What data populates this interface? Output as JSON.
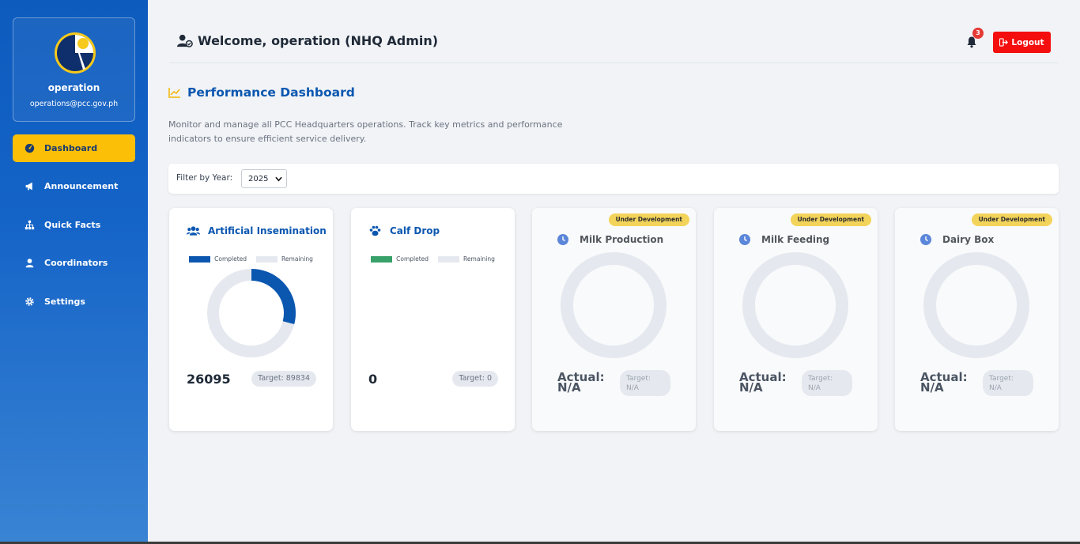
{
  "user": {
    "name": "operation",
    "email": "operations@pcc.gov.ph"
  },
  "sidebar": {
    "items": [
      {
        "label": "Dashboard",
        "icon": "gauge-icon",
        "active": true
      },
      {
        "label": "Announcement",
        "icon": "megaphone-icon"
      },
      {
        "label": "Quick Facts",
        "icon": "sitemap-icon"
      },
      {
        "label": "Coordinators",
        "icon": "user-icon"
      },
      {
        "label": "Settings",
        "icon": "gear-icon"
      }
    ]
  },
  "header": {
    "welcome": "Welcome, operation (NHQ Admin)",
    "notification_count": "3",
    "logout_label": "Logout"
  },
  "page": {
    "title": "Performance Dashboard",
    "description": "Monitor and manage all PCC Headquarters operations. Track key metrics and performance indicators to ensure efficient service delivery."
  },
  "filter": {
    "label": "Filter by Year:",
    "year": "2025"
  },
  "legend": {
    "completed": "Completed",
    "remaining": "Remaining"
  },
  "cards": [
    {
      "title": "Artificial Insemination",
      "actual": "26095",
      "target": "Target: 89834",
      "completed_fraction": 0.29,
      "color": "#0b57b0"
    },
    {
      "title": "Calf Drop",
      "actual": "0",
      "target": "Target: 0",
      "completed_fraction": 0,
      "color": "#38a169"
    }
  ],
  "dev_cards": [
    {
      "badge": "Under Development",
      "title": "Milk Production",
      "actual": "Actual: N/A",
      "target": "Target: N/A"
    },
    {
      "badge": "Under Development",
      "title": "Milk Feeding",
      "actual": "Actual: N/A",
      "target": "Target: N/A"
    },
    {
      "badge": "Under Development",
      "title": "Dairy Box",
      "actual": "Actual: N/A",
      "target": "Target: N/A"
    }
  ],
  "colors": {
    "sidebar": "#0d5bbd",
    "active": "#fcbf08",
    "accent": "#0b57b0",
    "logout": "#f40e0e",
    "ring": "#e5e9ef"
  }
}
